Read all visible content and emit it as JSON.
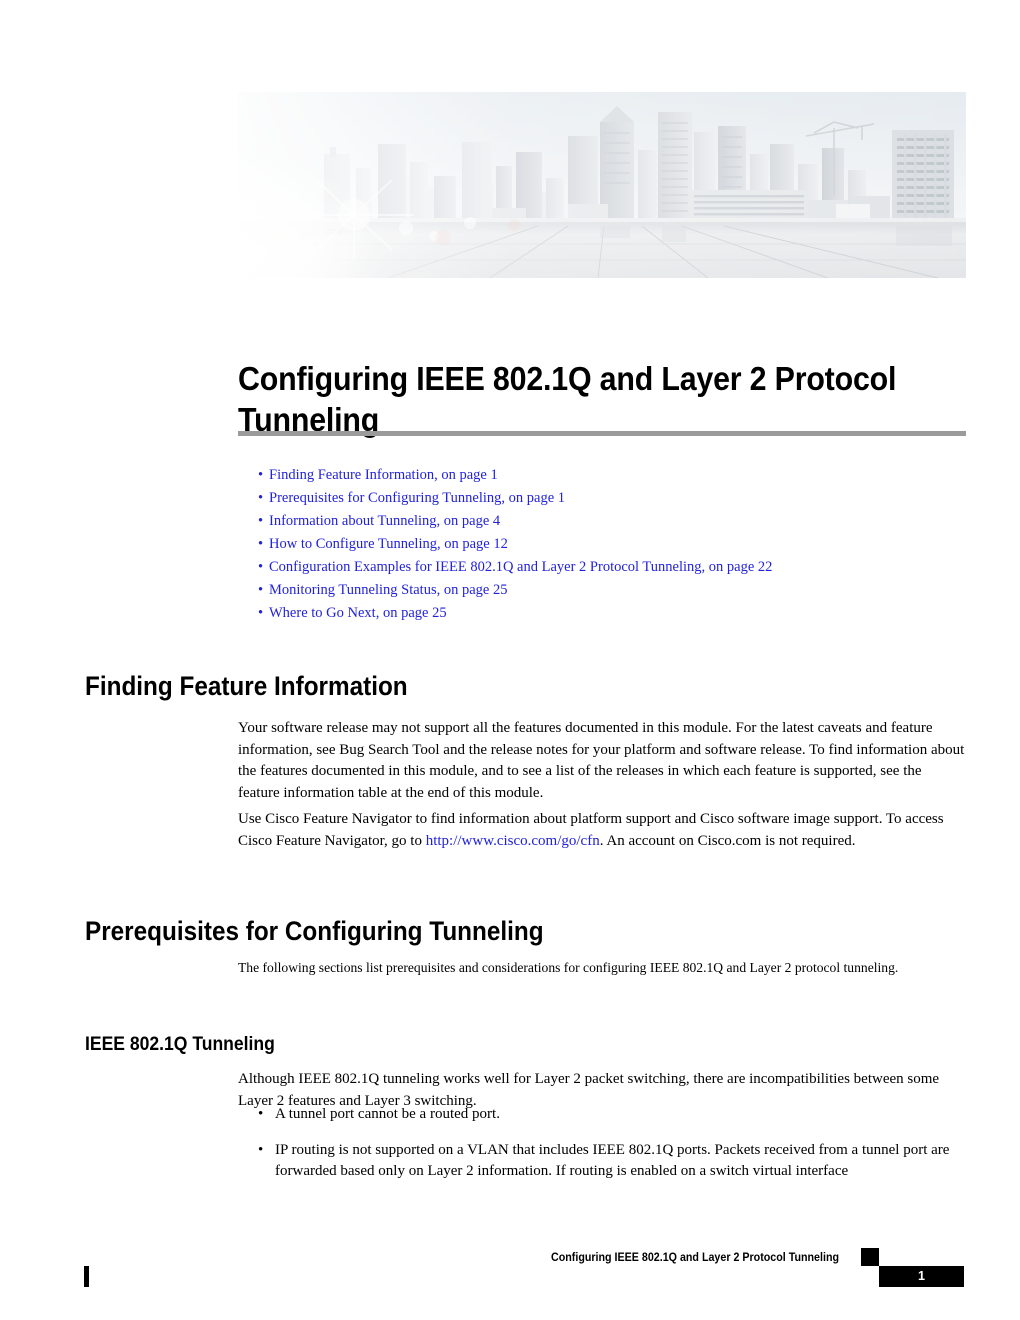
{
  "document": {
    "chapter_title": "Configuring IEEE 802.1Q and Layer 2 Protocol Tunneling",
    "banner_alt": "city-skyline-banner"
  },
  "toc_links": [
    {
      "bullet": "•",
      "label": "Finding Feature Information, on page 1"
    },
    {
      "bullet": "•",
      "label": "Prerequisites for Configuring Tunneling, on page 1"
    },
    {
      "bullet": "•",
      "label": "Information about Tunneling, on page 4"
    },
    {
      "bullet": "•",
      "label": "How to Configure Tunneling, on page 12"
    },
    {
      "bullet": "•",
      "label": "Configuration Examples for IEEE 802.1Q and Layer 2 Protocol Tunneling, on page 22"
    },
    {
      "bullet": "•",
      "label": "Monitoring Tunneling Status, on page 25"
    },
    {
      "bullet": "•",
      "label": "Where to Go Next, on page 25"
    }
  ],
  "sections": {
    "finding_feature_information": {
      "heading": "Finding Feature Information",
      "paragraph_1": "Your software release may not support all the features documented in this module. For the latest caveats and feature information, see Bug Search Tool and the release notes for your platform and software release. To find information about the features documented in this module, and to see a list of the releases in which each feature is supported, see the feature information table at the end of this module.",
      "paragraph_2_before_link": "Use Cisco Feature Navigator to find information about platform support and Cisco software image support. To access Cisco Feature Navigator, go to ",
      "paragraph_2_link": "http://www.cisco.com/go/cfn",
      "paragraph_2_after_link": ". An account on Cisco.com is not required."
    },
    "prerequisites": {
      "heading": "Prerequisites for Configuring Tunneling",
      "paragraph": "The following sections list prerequisites and considerations for configuring IEEE 802.1Q and Layer 2 protocol tunneling."
    },
    "ieee_tunneling": {
      "heading": "IEEE 802.1Q Tunneling",
      "paragraph": "Although IEEE 802.1Q tunneling works well for Layer 2 packet switching, there are incompatibilities between some Layer 2 features and Layer 3 switching.",
      "bullets": [
        {
          "bullet": "•",
          "text": "A tunnel port cannot be a routed port."
        },
        {
          "bullet": "•",
          "text": "IP routing is not supported on a VLAN that includes IEEE 802.1Q ports. Packets received from a tunnel port are forwarded based only on Layer 2 information. If routing is enabled on a switch virtual interface"
        }
      ]
    }
  },
  "footer": {
    "title": "Configuring IEEE 802.1Q and Layer 2 Protocol Tunneling",
    "page_number": "1"
  },
  "colors": {
    "link": "#2222dd",
    "rule": "#9b9b9b",
    "footer_bar": "#000000"
  }
}
